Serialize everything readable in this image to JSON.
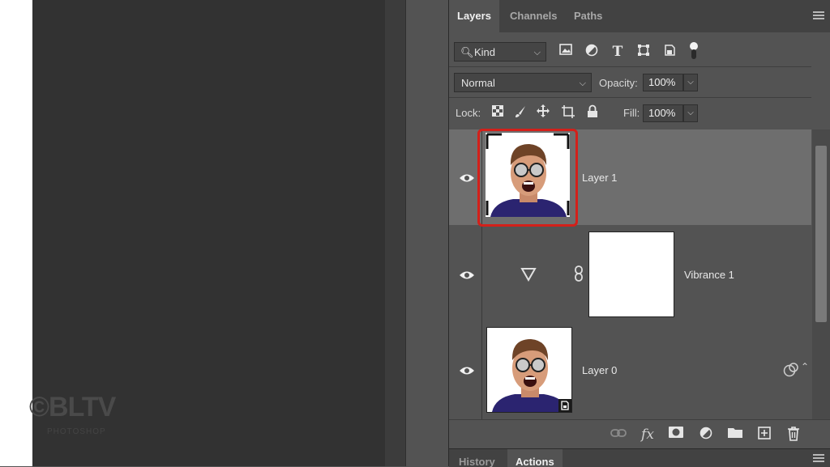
{
  "watermark": {
    "main": "©BLTV",
    "sub": "PHOTOSHOP"
  },
  "tabs": [
    {
      "label": "Layers",
      "active": true
    },
    {
      "label": "Channels",
      "active": false
    },
    {
      "label": "Paths",
      "active": false
    }
  ],
  "filter": {
    "kind_label": "Kind",
    "icons": [
      "image-filter-icon",
      "adjustment-filter-icon",
      "type-filter-icon",
      "shape-filter-icon",
      "smart-object-filter-icon"
    ]
  },
  "blend": {
    "mode": "Normal",
    "opacity_label": "Opacity:",
    "opacity_value": "100%"
  },
  "lock": {
    "label": "Lock:",
    "fill_label": "Fill:",
    "fill_value": "100%"
  },
  "layers": [
    {
      "name": "Layer 1",
      "selected": true,
      "type": "pixel"
    },
    {
      "name": "Vibrance 1",
      "selected": false,
      "type": "adjustment"
    },
    {
      "name": "Layer 0",
      "selected": false,
      "type": "smart-object"
    }
  ],
  "lower_tabs": [
    {
      "label": "History",
      "active": false
    },
    {
      "label": "Actions",
      "active": true
    }
  ],
  "colors": {
    "highlight": "#d3201a",
    "panel_bg": "#535353",
    "selected_bg": "#6e6e6e"
  }
}
